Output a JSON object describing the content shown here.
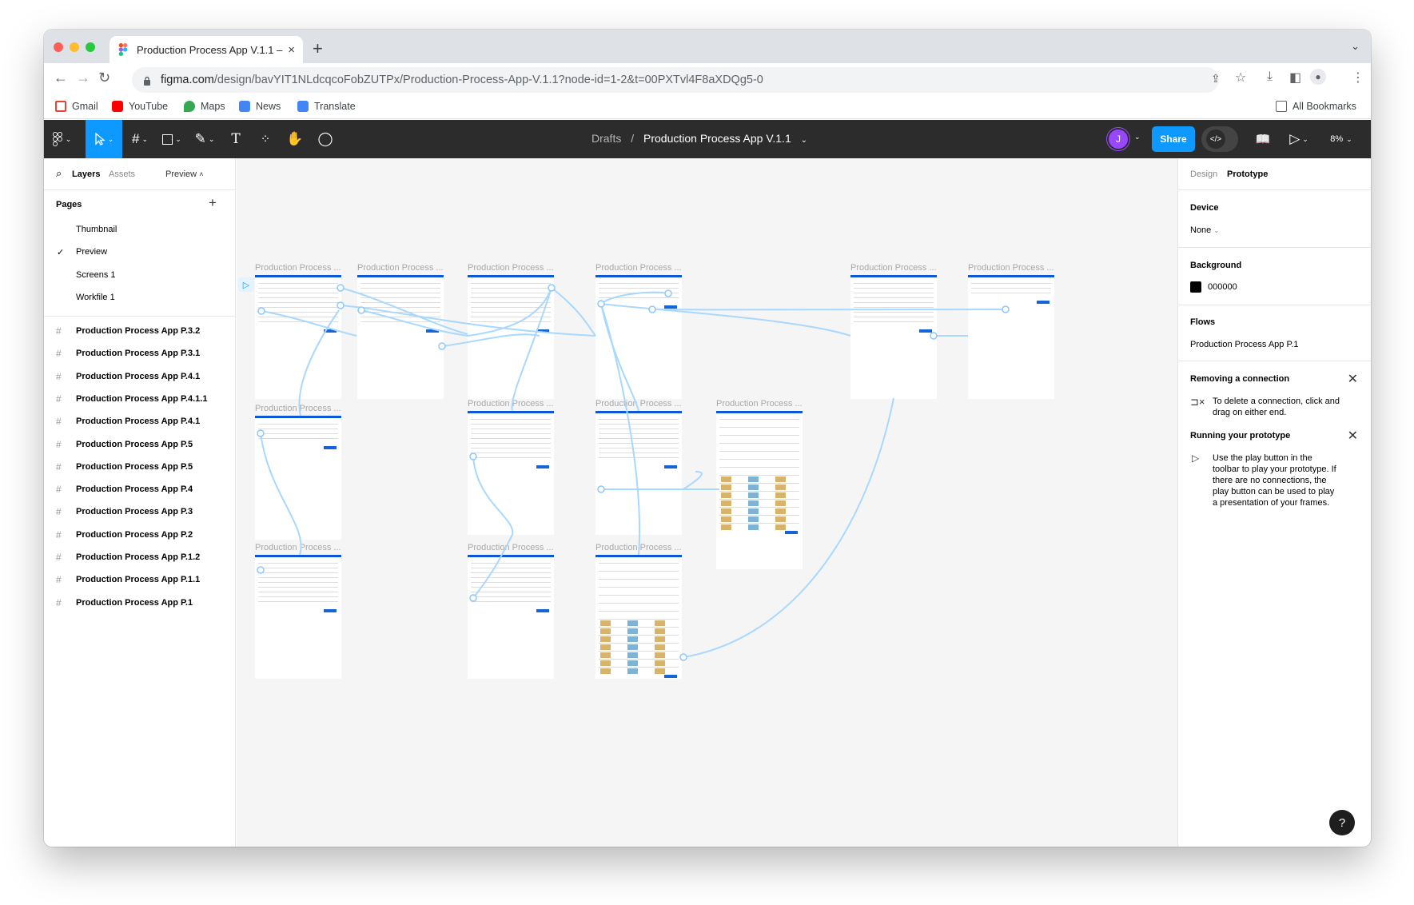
{
  "browser": {
    "tab_title": "Production Process App V.1.1 –",
    "tab_close": "×",
    "new_tab": "+",
    "url_host": "figma.com",
    "url_path": "/design/bavYIT1NLdcqcoFobZUTPx/Production-Process-App-V.1.1?node-id=1-2&t=00PXTvl4F8aXDQg5-0",
    "bookmarks": [
      {
        "label": "Gmail",
        "color": "#ea4335"
      },
      {
        "label": "YouTube",
        "color": "#ff0000"
      },
      {
        "label": "Maps",
        "color": "#34a853"
      },
      {
        "label": "News",
        "color": "#4285f4"
      },
      {
        "label": "Translate",
        "color": "#4285f4"
      }
    ],
    "all_bookmarks": "All Bookmarks"
  },
  "figma": {
    "breadcrumb_parent": "Drafts",
    "breadcrumb_sep": "/",
    "file_name": "Production Process App V.1.1",
    "avatar_initial": "J",
    "share_label": "Share",
    "zoom": "8%",
    "accent": "#0d99ff"
  },
  "left_panel": {
    "tabs": {
      "layers": "Layers",
      "assets": "Assets",
      "preview": "Preview"
    },
    "pages_header": "Pages",
    "pages": [
      "Thumbnail",
      "Preview",
      "Screens 1",
      "Workfile 1"
    ],
    "selected_page": "Preview",
    "layers": [
      "Production Process App P.3.2",
      "Production Process App P.3.1",
      "Production Process App P.4.1",
      "Production Process App P.4.1.1",
      "Production Process App P.4.1",
      "Production Process App P.5",
      "Production Process App P.5",
      "Production Process App P.4",
      "Production Process App P.3",
      "Production Process App P.2",
      "Production Process App P.1.2",
      "Production Process App P.1.1",
      "Production Process App P.1"
    ]
  },
  "canvas": {
    "frame_label": "Production Process ..."
  },
  "right_panel": {
    "tabs": {
      "design": "Design",
      "prototype": "Prototype"
    },
    "device_header": "Device",
    "device_value": "None",
    "background_header": "Background",
    "background_value": "000000",
    "flows_header": "Flows",
    "flow_name": "Production Process App P.1",
    "removing_header": "Removing a connection",
    "removing_text": "To delete a connection, click and drag on either end.",
    "running_header": "Running your prototype",
    "running_text": "Use the play button in the toolbar to play your prototype. If there are no connections, the play button can be used to play a presentation of your frames.",
    "help": "?"
  }
}
